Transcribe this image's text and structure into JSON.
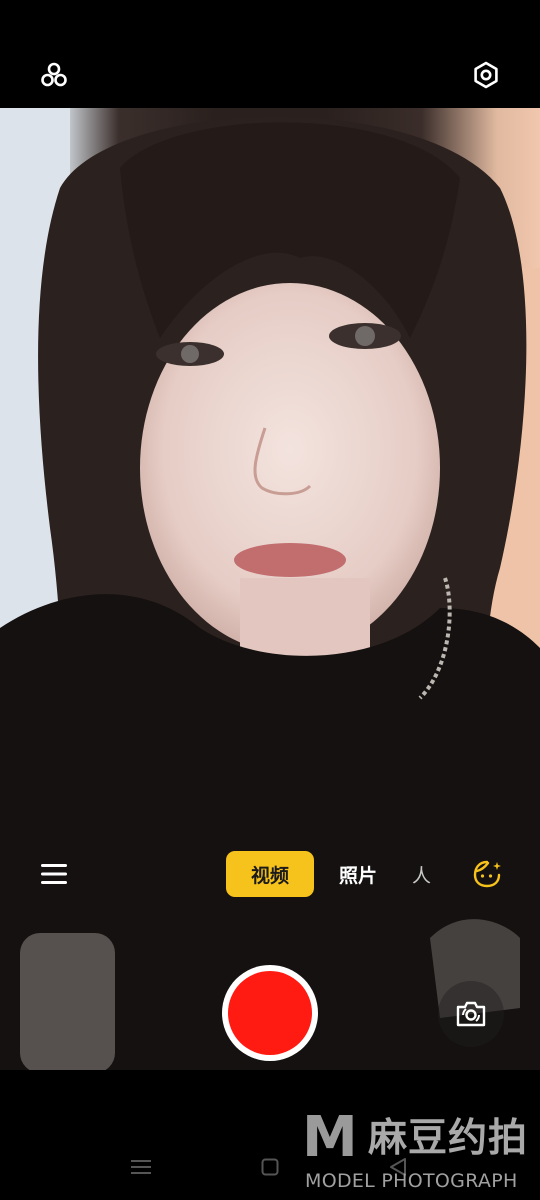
{
  "camera": {
    "modes": {
      "video": "视频",
      "photo": "照片",
      "portrait": "人"
    },
    "active_mode": "video"
  },
  "watermark": {
    "logo_letter": "M",
    "chinese": "麻豆约拍",
    "english": "MODEL PHOTOGRAPH"
  },
  "icons": {
    "filters": "filters-icon",
    "settings": "settings-icon",
    "menu": "menu-icon",
    "beauty": "beauty-face-icon",
    "flip": "flip-camera-icon",
    "nav_recent": "recent-apps-icon",
    "nav_home": "home-icon",
    "nav_back": "back-icon"
  },
  "colors": {
    "accent": "#f6c21c",
    "record": "#ff1a12",
    "background": "#000000"
  }
}
